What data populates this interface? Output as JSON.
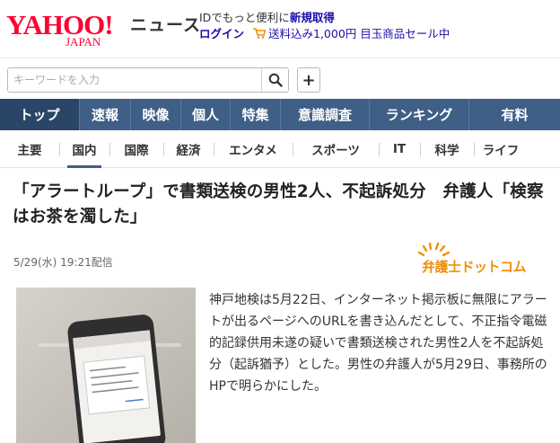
{
  "header": {
    "logo_main": "YAHOO!",
    "logo_sub": "JAPAN",
    "service": "ニュース",
    "promo_line1_prefix": "IDでもっと便利に",
    "promo_line1_link": "新規取得",
    "promo_login": "ログイン",
    "promo_line2": "送料込み1,000円 目玉商品セール中"
  },
  "search": {
    "placeholder": "キーワードを入力",
    "plus_label": "+"
  },
  "nav": {
    "items": [
      {
        "label": "トップ"
      },
      {
        "label": "速報"
      },
      {
        "label": "映像"
      },
      {
        "label": "個人"
      },
      {
        "label": "特集"
      },
      {
        "label": "意識調査"
      },
      {
        "label": "ランキング"
      },
      {
        "label": "有料"
      }
    ]
  },
  "subnav": {
    "items": [
      {
        "label": "主要"
      },
      {
        "label": "国内"
      },
      {
        "label": "国際"
      },
      {
        "label": "経済"
      },
      {
        "label": "エンタメ"
      },
      {
        "label": "スポーツ"
      },
      {
        "label": "IT"
      },
      {
        "label": "科学"
      },
      {
        "label": "ライフ"
      }
    ]
  },
  "article": {
    "title": "「アラートループ」で書類送検の男性2人、不起訴処分　弁護人「検察はお茶を濁した」",
    "date": "5/29(水) 19:21配信",
    "source": "弁護士ドットコム",
    "body": "神戸地検は5月22日、インターネット掲示板に無限にアラートが出るページへのURLを書き込んだとして、不正指令電磁的記録供用未遂の疑いで書類送検された男性2人を不起訴処分（起訴猶予）とした。男性の弁護人が5月29日、事務所のHPで明らかにした。"
  },
  "colors": {
    "brand_red": "#ff0033",
    "nav_bg": "#3f5f86",
    "nav_active": "#2a4568",
    "source_orange": "#f0900a",
    "link": "#1a0dab"
  },
  "icons": {
    "search": "magnifier-icon",
    "cart": "cart-icon",
    "plus": "plus-icon"
  }
}
